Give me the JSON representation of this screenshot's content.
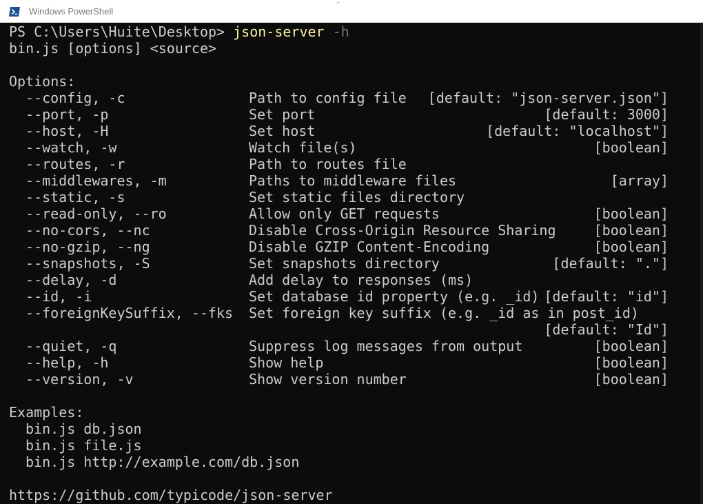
{
  "window": {
    "title": "Windows PowerShell"
  },
  "console": {
    "prompt": "PS C:\\Users\\Huite\\Desktop> ",
    "command": "json-server",
    "command_flag": " -h",
    "usage": "bin.js [options] <source>",
    "options_header": "Options:",
    "options": [
      {
        "opt": "--config, -c",
        "desc": "Path to config file",
        "type": "[default: \"json-server.json\"]"
      },
      {
        "opt": "--port, -p",
        "desc": "Set port",
        "type": "[default: 3000]"
      },
      {
        "opt": "--host, -H",
        "desc": "Set host",
        "type": "[default: \"localhost\"]"
      },
      {
        "opt": "--watch, -w",
        "desc": "Watch file(s)",
        "type": "[boolean]"
      },
      {
        "opt": "--routes, -r",
        "desc": "Path to routes file",
        "type": ""
      },
      {
        "opt": "--middlewares, -m",
        "desc": "Paths to middleware files",
        "type": "[array]"
      },
      {
        "opt": "--static, -s",
        "desc": "Set static files directory",
        "type": ""
      },
      {
        "opt": "--read-only, --ro",
        "desc": "Allow only GET requests",
        "type": "[boolean]"
      },
      {
        "opt": "--no-cors, --nc",
        "desc": "Disable Cross-Origin Resource Sharing",
        "type": "[boolean]"
      },
      {
        "opt": "--no-gzip, --ng",
        "desc": "Disable GZIP Content-Encoding",
        "type": "[boolean]"
      },
      {
        "opt": "--snapshots, -S",
        "desc": "Set snapshots directory",
        "type": "[default: \".\"]"
      },
      {
        "opt": "--delay, -d",
        "desc": "Add delay to responses (ms)",
        "type": ""
      },
      {
        "opt": "--id, -i",
        "desc": "Set database id property (e.g. _id)",
        "type": "[default: \"id\"]"
      },
      {
        "opt": "--foreignKeySuffix, --fks",
        "desc": "Set foreign key suffix (e.g. _id as in post_id)",
        "type": ""
      },
      {
        "opt": "",
        "desc": "",
        "type": "[default: \"Id\"]"
      },
      {
        "opt": "--quiet, -q",
        "desc": "Suppress log messages from output",
        "type": "[boolean]"
      },
      {
        "opt": "--help, -h",
        "desc": "Show help",
        "type": "[boolean]"
      },
      {
        "opt": "--version, -v",
        "desc": "Show version number",
        "type": "[boolean]"
      }
    ],
    "examples_header": "Examples:",
    "examples": [
      "bin.js db.json",
      "bin.js file.js",
      "bin.js http://example.com/db.json"
    ],
    "footer_url": "https://github.com/typicode/json-server"
  },
  "colors": {
    "background": "#0c0c0c",
    "text": "#cccccc",
    "command": "#f9f1a5",
    "flag": "#767676",
    "titlebar": "#ffffff",
    "icon": "#1f4e8c"
  },
  "icons": {
    "app": "powershell-icon"
  }
}
